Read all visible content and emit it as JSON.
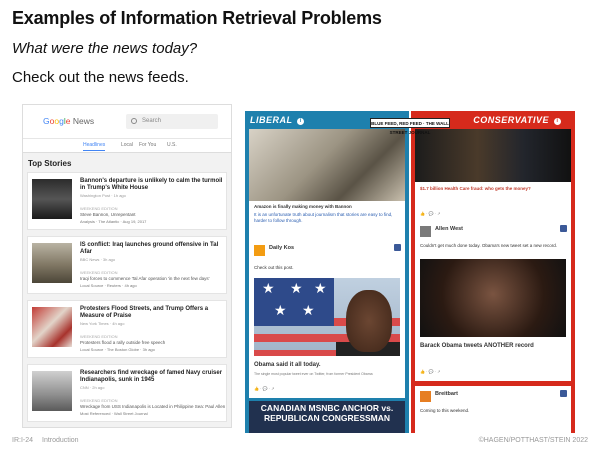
{
  "slide": {
    "title": "Examples of Information Retrieval Problems",
    "subtitle": "What were the news today?",
    "body": "Check out the news feeds.",
    "footer_left": "IR:I-24",
    "footer_section": "Introduction",
    "footer_right": "©HAGEN/POTTHAST/STEIN 2022"
  },
  "google_news": {
    "logo": "Google News",
    "search_placeholder": "Search",
    "tabs": [
      "Headlines",
      "Local",
      "For You",
      "U.S."
    ],
    "section": "Top Stories",
    "articles": [
      {
        "headline": "Bannon's departure is unlikely to calm the turmoil in Trump's White House",
        "source": "Washington Post · 1h ago",
        "sub1": "WEEKEND EDITION",
        "sub2": "Steve Bannon, Unrepentant",
        "sub3": "Analysis · The Atlantic · Aug 19, 2017"
      },
      {
        "headline": "IS conflict: Iraq launches ground offensive in Tal Afar",
        "source": "BBC News · 3h ago",
        "sub1": "WEEKEND EDITION",
        "sub2": "Iraqi forces to commence Tal Afar operation 'in the next few days'",
        "sub3": "Local Source · Reuters · 4h ago"
      },
      {
        "headline": "Protesters Flood Streets, and Trump Offers a Measure of Praise",
        "source": "New York Times · 4h ago",
        "sub1": "WEEKEND EDITION",
        "sub2": "Protesters flood a rally outside free speech",
        "sub3": "Local Source · The Boston Globe · 3h ago"
      },
      {
        "headline": "Researchers find wreckage of famed Navy cruiser Indianapolis, sunk in 1945",
        "source": "CNN · 2h ago",
        "sub1": "WEEKEND EDITION",
        "sub2": "Wreckage from USS Indianapolis is Located in Philippine Sea: Paul Allen",
        "sub3": "Most Referenced · Wall Street Journal"
      }
    ]
  },
  "blue_feed": {
    "liberal_label": "LIBERAL",
    "conservative_label": "CONSERVATIVE",
    "badge": "BLUE FEED, RED FEED · THE WALL STREET JOURNAL",
    "liberal_cards": [
      {
        "caption": "Amazon is finally making money with Bannon",
        "text": "It is an unfortunate truth about journalism that stories are easy to find, harder to follow through."
      },
      {
        "page": "Daily Kos",
        "caption": "Check out this post.",
        "quote": "Obama said it all today.",
        "quote_sub": "The single most popular tweet ever on Twitter, from former President Obama"
      },
      {
        "headline": "CANADIAN MSNBC ANCHOR vs. REPUBLICAN CONGRESSMAN"
      }
    ],
    "conservative_cards": [
      {
        "caption": "$1.7 billion Health Care fraud: who gets the money?"
      },
      {
        "page": "Allen West",
        "text": "Couldn't get much done today. Obama's new tweet set a new record.",
        "headline": "Barack Obama tweets ANOTHER record"
      },
      {
        "page": "Breitbart",
        "text": "Coming to this weekend."
      }
    ]
  }
}
